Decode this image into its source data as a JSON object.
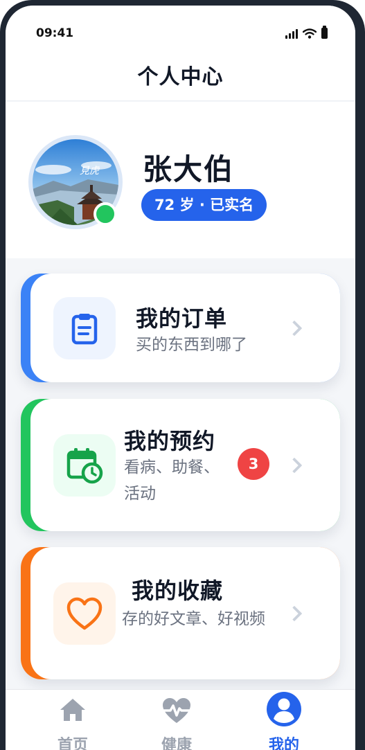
{
  "status_bar": {
    "time": "09:41"
  },
  "nav": {
    "title": "个人中心"
  },
  "profile": {
    "name": "张大伯",
    "badge": "72 岁 · 已实名",
    "status": "online",
    "avatar_caption": "見虎"
  },
  "menu": [
    {
      "title": "我的订单",
      "desc": "买的东西到哪了",
      "accent": "#3b82f6",
      "icon": "clipboard-icon",
      "icon_bg": "#eef4fe"
    },
    {
      "title": "我的预约",
      "desc": "看病、助餐、活动",
      "accent": "#22c55e",
      "icon": "calendar-clock-icon",
      "icon_bg": "#ecfdf3",
      "badge": "3"
    },
    {
      "title": "我的收藏",
      "desc": "存的好文章、好视频",
      "accent": "#f97316",
      "icon": "heart-icon",
      "icon_bg": "#fff4ea"
    }
  ],
  "tabs": [
    {
      "label": "首页",
      "icon": "home-icon",
      "active": false
    },
    {
      "label": "健康",
      "icon": "heart-pulse-icon",
      "active": false
    },
    {
      "label": "我的",
      "icon": "user-circle-icon",
      "active": true
    }
  ],
  "colors": {
    "primary": "#2563eb",
    "badge_red": "#ef4444",
    "online": "#22c55e"
  }
}
